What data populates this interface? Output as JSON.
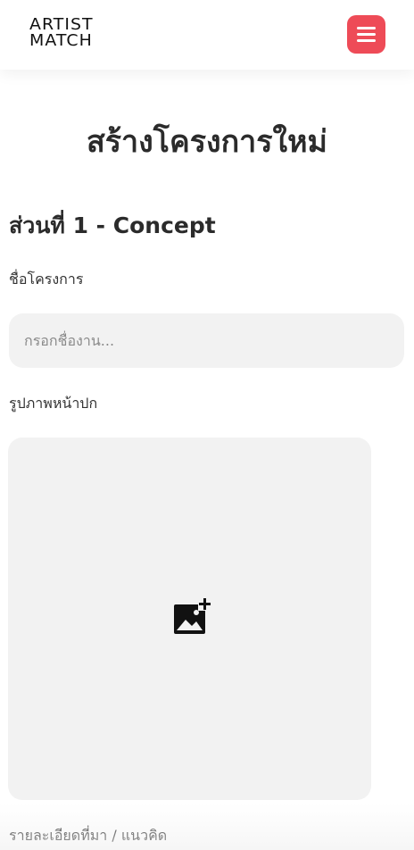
{
  "header": {
    "logo_line1": "ARTIST",
    "logo_line2": "MATCH",
    "menu_icon": "hamburger-menu-icon",
    "accent_color": "#ee4b57"
  },
  "main": {
    "page_title": "สร้างโครงการใหม่",
    "section_title": "ส่วนที่ 1 - Concept",
    "project_name": {
      "label": "ชื่อโครงการ",
      "placeholder": "กรอกชื่องาน...",
      "value": ""
    },
    "cover_image": {
      "label": "รูปภาพหน้าปก",
      "icon": "add-photo-icon"
    },
    "detail": {
      "label": "รายละเอียดที่มา / แนวคิด"
    }
  }
}
